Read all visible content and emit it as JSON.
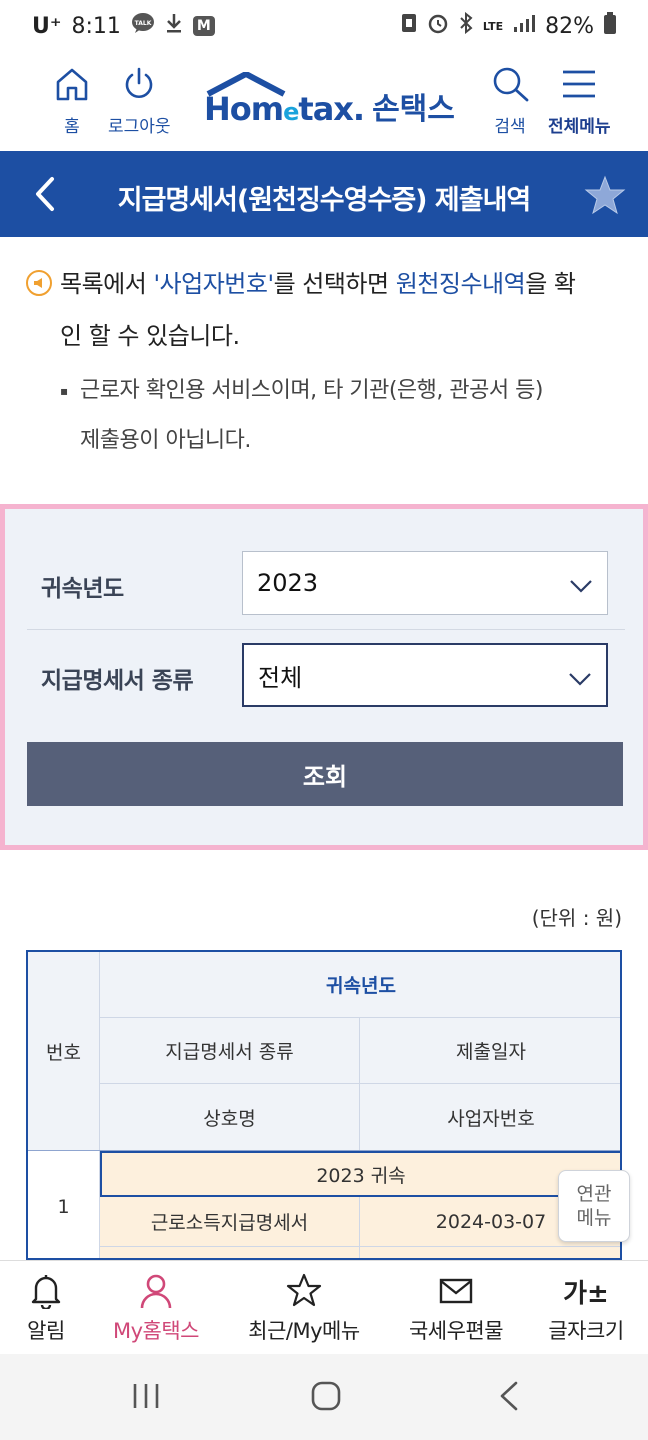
{
  "status_bar": {
    "carrier": "U⁺",
    "time": "8:11",
    "talk_badge": "TALK",
    "stock_badge": "M",
    "lte": "LTE",
    "battery": "82%"
  },
  "header": {
    "home_label": "홈",
    "logout_label": "로그아웃",
    "logo_text_a": "Hom",
    "logo_text_e": "e",
    "logo_text_b": "tax.",
    "logo_kr": "손택스",
    "search_label": "검색",
    "menu_label": "전체메뉴"
  },
  "title_bar": {
    "title": "지급명세서(원천징수영수증) 제출내역"
  },
  "notice": {
    "part1": "목록에서 ",
    "highlight1": "'사업자번호'",
    "part2": "를 선택하면 ",
    "highlight2": "원천징수내역",
    "part3": "을 확",
    "line2": "인 할 수 있습니다.",
    "bullet_line1": "근로자 확인용 서비스이며, 타 기관(은행, 관공서 등)",
    "bullet_line2": "제출용이 아닙니다."
  },
  "search_panel": {
    "year_label": "귀속년도",
    "year_value": "2023",
    "type_label": "지급명세서 종류",
    "type_value": "전체",
    "search_button": "조회"
  },
  "table": {
    "unit": "(단위 : 원)",
    "headers": {
      "no": "번호",
      "year": "귀속년도",
      "type": "지급명세서 종류",
      "date": "제출일자",
      "company": "상호명",
      "biz_no": "사업자번호"
    },
    "rows": [
      {
        "no": "1",
        "year": "2023 귀속",
        "type": "근로소득지급명세서",
        "date": "2024-03-07"
      }
    ]
  },
  "related_menu": {
    "line1": "연관",
    "line2": "메뉴"
  },
  "bottom_nav": {
    "items": [
      {
        "label": "알림"
      },
      {
        "label": "My홈택스"
      },
      {
        "label": "최근/My메뉴"
      },
      {
        "label": "국세우편물"
      },
      {
        "label": "글자크기",
        "icon_text": "가±"
      }
    ]
  },
  "colors": {
    "brand_blue": "#1d4fa3",
    "panel_border": "#f5b3cf",
    "search_button": "#566079",
    "active_nav": "#d04878",
    "row_highlight": "#fdf0dd"
  }
}
